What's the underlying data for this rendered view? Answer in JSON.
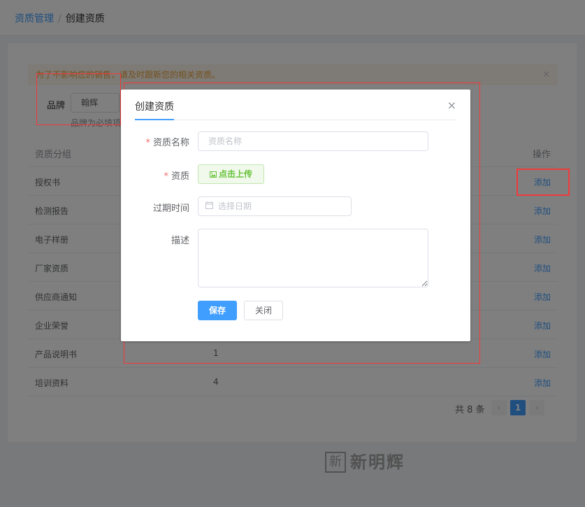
{
  "breadcrumb": {
    "root": "资质管理",
    "separator": "/",
    "current": "创建资质"
  },
  "alert": {
    "text": "为了不影响您的销售，请及时跟新您的相关资质。",
    "close": "×"
  },
  "brand": {
    "label": "品牌",
    "value": "翰辉",
    "hint": "品牌为必填项"
  },
  "table": {
    "columns": [
      "资质分组",
      "",
      "操作"
    ],
    "rows": [
      {
        "group": "授权书",
        "count": "",
        "action": "添加"
      },
      {
        "group": "检测报告",
        "count": "",
        "action": "添加"
      },
      {
        "group": "电子样册",
        "count": "",
        "action": "添加"
      },
      {
        "group": "厂家资质",
        "count": "",
        "action": "添加"
      },
      {
        "group": "供应商通知",
        "count": "",
        "action": "添加"
      },
      {
        "group": "企业荣誉",
        "count": "",
        "action": "添加"
      },
      {
        "group": "产品说明书",
        "count": "1",
        "action": "添加"
      },
      {
        "group": "培训资料",
        "count": "4",
        "action": "添加"
      }
    ]
  },
  "pagination": {
    "total": "共 8 条",
    "prev": "‹",
    "current": "1",
    "next": "›"
  },
  "logo": {
    "mark": "新",
    "name": "新明辉"
  },
  "dialog": {
    "title": "创建资质",
    "close": "×",
    "fields": {
      "name_label": "资质名称",
      "name_placeholder": "资质名称",
      "file_label": "资质",
      "upload_label": "点击上传",
      "upload_icon": "picture-icon",
      "expire_label": "过期时间",
      "expire_placeholder": "选择日期",
      "desc_label": "描述",
      "desc_value": ""
    },
    "required_mark": "*",
    "save_label": "保存",
    "close_label": "关闭"
  }
}
